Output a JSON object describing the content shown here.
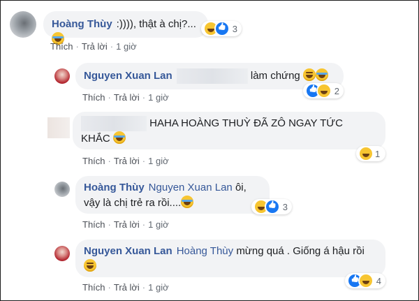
{
  "comments": [
    {
      "author": "Hoàng Thùy",
      "text": ":)))), thật à chị?...",
      "reaction_count": "3",
      "actions": {
        "like": "Thích",
        "reply": "Trả lời",
        "time": "1 giờ"
      }
    },
    {
      "author": "Nguyen Xuan Lan",
      "text": "làm chứng",
      "reaction_count": "2",
      "actions": {
        "like": "Thích",
        "reply": "Trả lời",
        "time": "1 giờ"
      }
    },
    {
      "author": "",
      "text_line1": "HAHA HOÀNG THUỲ ĐÃ ZÔ NGAY TỨC",
      "text_line2": "KHẮC",
      "reaction_count": "1",
      "actions": {
        "like": "Thích",
        "reply": "Trả lời",
        "time": "1 giờ"
      }
    },
    {
      "author": "Hoàng Thùy",
      "mention": "Nguyen Xuan Lan",
      "text_line1": "ôi,",
      "text_line2": "vậy là chị trẻ ra rồi....",
      "reaction_count": "3",
      "actions": {
        "like": "Thích",
        "reply": "Trả lời",
        "time": "1 giờ"
      }
    },
    {
      "author": "Nguyen Xuan Lan",
      "mention": "Hoàng Thùy",
      "text_line1": "mừng quá . Giống á hậu rồi",
      "reaction_count": "4",
      "actions": {
        "like": "Thích",
        "reply": "Trả lời",
        "time": "1 giờ"
      }
    }
  ],
  "icons": {
    "haha": "haha-emoji-icon",
    "like": "like-reaction-icon",
    "wink": "wink-emoji-icon"
  },
  "colors": {
    "name": "#365899",
    "bubble": "#f2f3f5",
    "like_blue": "#1877f2",
    "haha_yellow": "#f7c531"
  }
}
